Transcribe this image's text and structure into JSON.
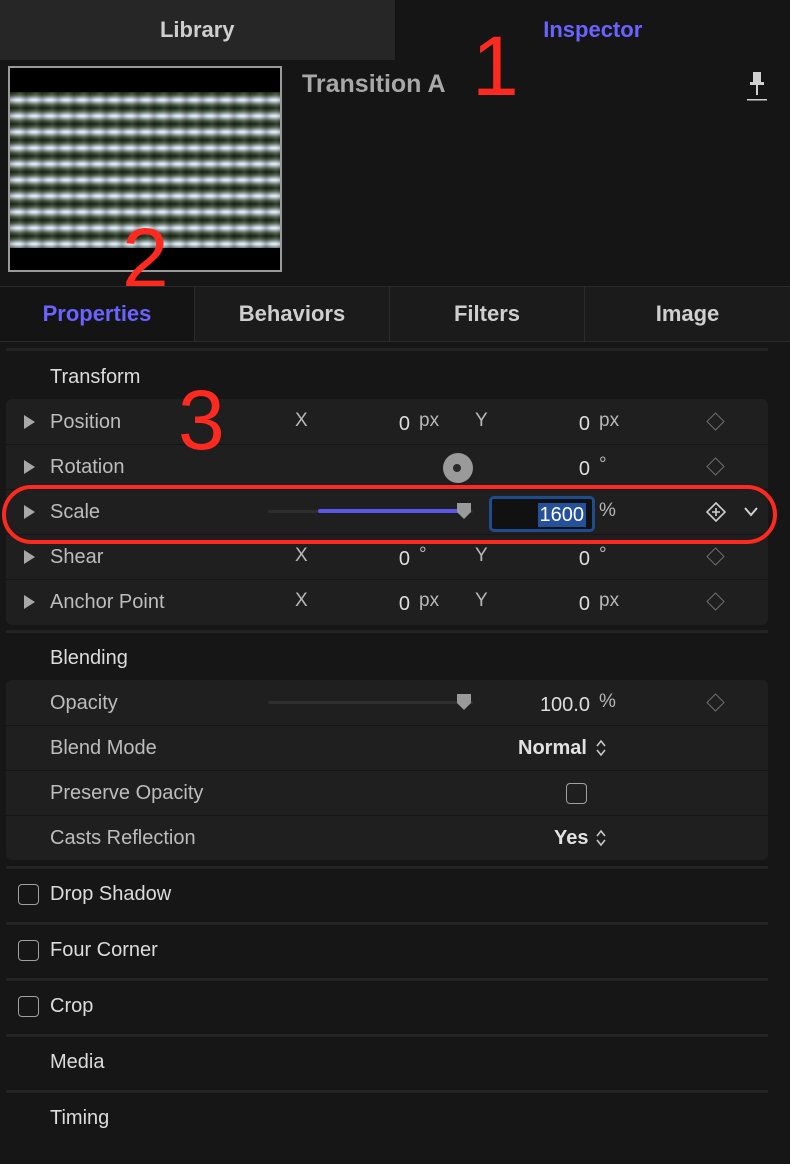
{
  "top_tabs": {
    "library": "Library",
    "inspector": "Inspector"
  },
  "preview": {
    "title": "Transition A"
  },
  "annotations": {
    "one": "1",
    "two": "2",
    "three": "3"
  },
  "sub_tabs": [
    "Properties",
    "Behaviors",
    "Filters",
    "Image"
  ],
  "transform": {
    "heading": "Transform",
    "position": {
      "label": "Position",
      "x_axis": "X",
      "x_value": "0",
      "x_unit": "px",
      "y_axis": "Y",
      "y_value": "0",
      "y_unit": "px"
    },
    "rotation": {
      "label": "Rotation",
      "value": "0",
      "unit": "°"
    },
    "scale": {
      "label": "Scale",
      "value": "1600",
      "unit": "%"
    },
    "shear": {
      "label": "Shear",
      "x_axis": "X",
      "x_value": "0",
      "x_unit": "°",
      "y_axis": "Y",
      "y_value": "0",
      "y_unit": "°"
    },
    "anchor": {
      "label": "Anchor Point",
      "x_axis": "X",
      "x_value": "0",
      "x_unit": "px",
      "y_axis": "Y",
      "y_value": "0",
      "y_unit": "px"
    }
  },
  "blending": {
    "heading": "Blending",
    "opacity": {
      "label": "Opacity",
      "value": "100.0",
      "unit": "%"
    },
    "blend_mode": {
      "label": "Blend Mode",
      "value": "Normal"
    },
    "preserve_opacity": {
      "label": "Preserve Opacity",
      "checked": false
    },
    "casts_reflection": {
      "label": "Casts Reflection",
      "value": "Yes"
    }
  },
  "sections": {
    "drop_shadow": "Drop Shadow",
    "four_corner": "Four Corner",
    "crop": "Crop",
    "media": "Media",
    "timing": "Timing"
  },
  "colors": {
    "accent": "#6a63ff",
    "annotation": "#ff2a1f",
    "field_border": "#1e4c8c"
  },
  "icons": [
    "pin-icon",
    "disclosure-triangle-icon",
    "keyframe-diamond-icon",
    "rotation-dial-icon",
    "chevron-down-icon",
    "up-down-chevron-icon",
    "checkbox-icon"
  ]
}
